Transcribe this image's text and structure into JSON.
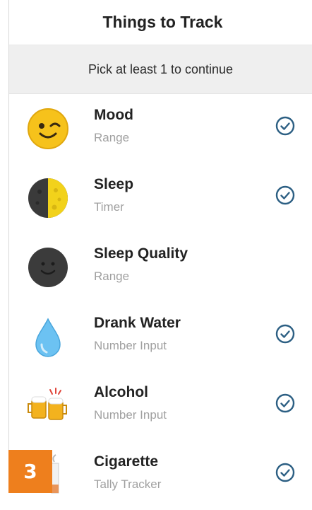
{
  "header": {
    "title": "Things to Track"
  },
  "subheader": {
    "text": "Pick at least 1 to continue"
  },
  "items": [
    {
      "name": "Mood",
      "type": "Range",
      "icon": "winking-face-icon",
      "checked": true
    },
    {
      "name": "Sleep",
      "type": "Timer",
      "icon": "half-moon-icon",
      "checked": true
    },
    {
      "name": "Sleep Quality",
      "type": "Range",
      "icon": "dark-smiley-icon",
      "checked": false
    },
    {
      "name": "Drank Water",
      "type": "Number Input",
      "icon": "water-drop-icon",
      "checked": true
    },
    {
      "name": "Alcohol",
      "type": "Number Input",
      "icon": "beer-mugs-icon",
      "checked": true
    },
    {
      "name": "Cigarette",
      "type": "Tally Tracker",
      "icon": "cigarette-icon",
      "checked": true
    }
  ],
  "badge": {
    "label": "3"
  },
  "colors": {
    "check": "#2c5f83",
    "badge": "#ee7f1d",
    "subheader_bg": "#efefef"
  }
}
